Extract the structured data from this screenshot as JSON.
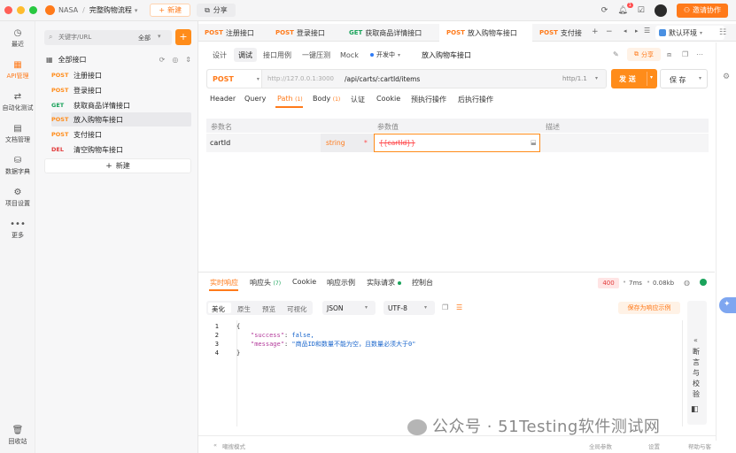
{
  "titlebar": {
    "project": "NASA",
    "separator": "/",
    "flow": "完整购物流程",
    "new_label": "新建",
    "share_label": "分享",
    "notifications": "1",
    "invite_label": "邀请协作"
  },
  "rail": [
    {
      "label": "最近",
      "icon": "clock-icon"
    },
    {
      "label": "API管理",
      "icon": "api-icon",
      "active": true
    },
    {
      "label": "自动化测试",
      "icon": "flow-icon"
    },
    {
      "label": "文档管理",
      "icon": "doc-icon"
    },
    {
      "label": "数据字典",
      "icon": "dict-icon"
    },
    {
      "label": "项目设置",
      "icon": "settings-icon"
    },
    {
      "label": "更多",
      "icon": "more-icon"
    }
  ],
  "rail_bottom": {
    "label": "回收站",
    "icon": "trash-icon"
  },
  "tree": {
    "search_placeholder": "关键字/URL",
    "filter_label": "全部",
    "root_label": "全部接口",
    "items": [
      {
        "method": "POST",
        "label": "注册接口"
      },
      {
        "method": "POST",
        "label": "登录接口"
      },
      {
        "method": "GET",
        "label": "获取商品详情接口"
      },
      {
        "method": "POST",
        "label": "放入购物车接口",
        "selected": true
      },
      {
        "method": "POST",
        "label": "支付接口"
      },
      {
        "method": "DEL",
        "label": "清空购物车接口"
      }
    ],
    "new_label": "新建"
  },
  "tabs": [
    {
      "method": "POST",
      "label": "注册接口"
    },
    {
      "method": "POST",
      "label": "登录接口"
    },
    {
      "method": "GET",
      "label": "获取商品详情接口"
    },
    {
      "method": "POST",
      "label": "放入购物车接口",
      "active": true
    },
    {
      "method": "POST",
      "label": "支付接"
    }
  ],
  "env_label": "默认环境",
  "mode_tabs": [
    "设计",
    "调试",
    "接口用例",
    "一键压测",
    "Mock"
  ],
  "status_label": "开发中",
  "api_name": "放入购物车接口",
  "share2_label": "分享",
  "url": {
    "method": "POST",
    "base": "http://127.0.0.1:3000",
    "path": "/api/carts/:cartId/items",
    "protocol": "http/1.1"
  },
  "send_label": "发 送",
  "save_label": "保 存",
  "subtabs": [
    {
      "label": "Header"
    },
    {
      "label": "Query"
    },
    {
      "label": "Path",
      "count": "(1)",
      "active": true
    },
    {
      "label": "Body",
      "count": "(1)"
    },
    {
      "label": "认证"
    },
    {
      "label": "Cookie"
    },
    {
      "label": "预执行操作"
    },
    {
      "label": "后执行操作"
    }
  ],
  "params": {
    "headers": [
      "参数名",
      "参数值",
      "描述"
    ],
    "row": {
      "name": "cartId",
      "type": "string",
      "required_mark": "*",
      "value": "{{cartId}}"
    }
  },
  "resp_tabs": [
    {
      "label": "实时响应",
      "active": true
    },
    {
      "label": "响应头",
      "count": "(7)"
    },
    {
      "label": "Cookie"
    },
    {
      "label": "响应示例"
    },
    {
      "label": "实际请求"
    },
    {
      "label": "控制台"
    }
  ],
  "resp_meta": {
    "status": "400",
    "time": "7ms",
    "size": "0.08kb"
  },
  "view_tabs": [
    "美化",
    "原生",
    "预览",
    "可视化"
  ],
  "format": "JSON",
  "encoding": "UTF-8",
  "save_example_label": "保存为响应示例",
  "code_lines": [
    {
      "n": "1",
      "text": "{"
    },
    {
      "n": "2",
      "key": "\"success\"",
      "val": "false,"
    },
    {
      "n": "3",
      "key": "\"message\"",
      "val": "\"商品ID和数量不能为空，且数量必须大于0\""
    },
    {
      "n": "4",
      "text": "}"
    }
  ],
  "assert_label": "断言与校验",
  "footer": {
    "left": "嘲搜模式",
    "global_params": "全局参数",
    "settings": "设置",
    "help": "帮助与客服"
  },
  "watermark": "公众号 · 51Testing软件测试网"
}
